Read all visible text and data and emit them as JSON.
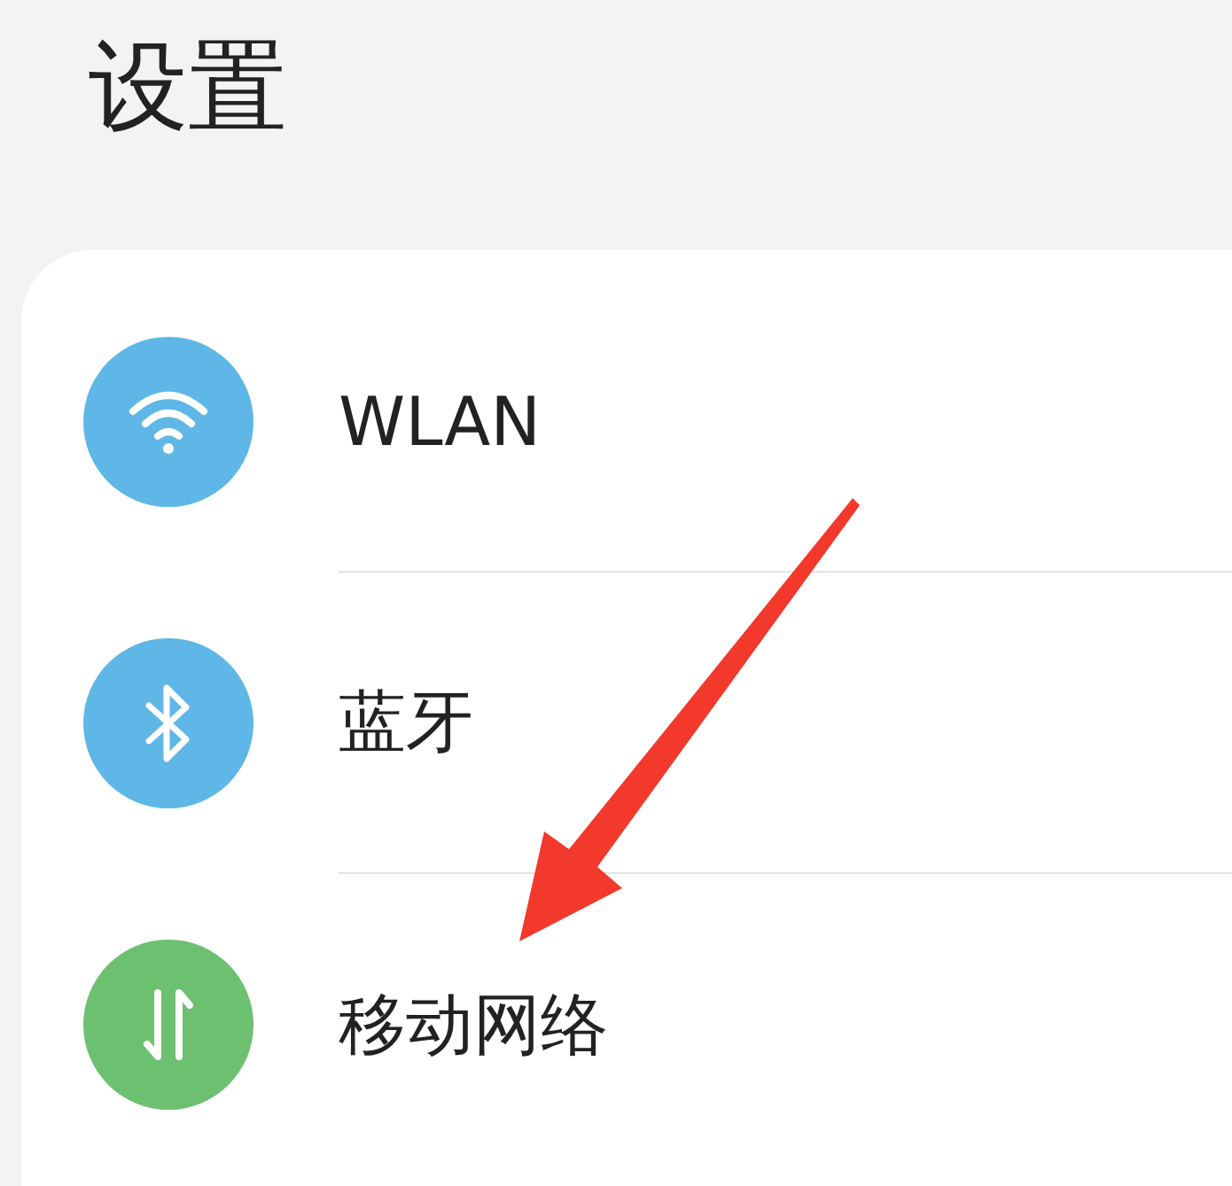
{
  "title": "设置",
  "items": [
    {
      "kind": "wlan",
      "label": "WLAN",
      "color": "#5eb7e6"
    },
    {
      "kind": "bluetooth",
      "label": "蓝牙",
      "color": "#5eb7e6"
    },
    {
      "kind": "mobile-data",
      "label": "移动网络",
      "color": "#6cc070"
    }
  ],
  "annotation": {
    "kind": "arrow",
    "color": "#f2392c"
  }
}
